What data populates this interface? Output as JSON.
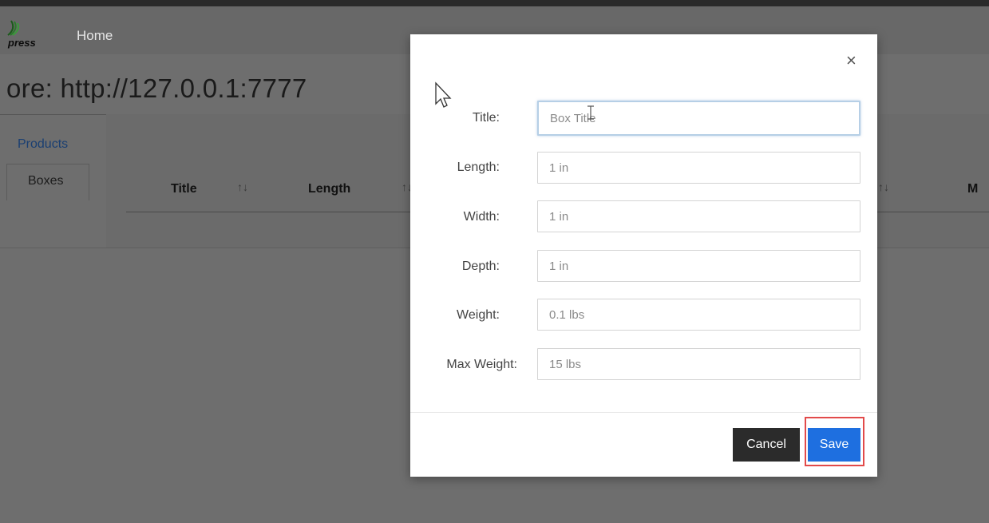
{
  "nav": {
    "logo_text": "press",
    "home": "Home"
  },
  "store": {
    "title": "ore: http://127.0.0.1:7777"
  },
  "tabs": {
    "products": "Products",
    "boxes": "Boxes"
  },
  "table": {
    "headers": [
      "Title",
      "Length",
      "M"
    ],
    "sort_glyph": "↑↓"
  },
  "modal": {
    "close_glyph": "×",
    "fields": [
      {
        "label": "Title:",
        "placeholder": "Box Title",
        "value": ""
      },
      {
        "label": "Length:",
        "placeholder": "1 in",
        "value": ""
      },
      {
        "label": "Width:",
        "placeholder": "1 in",
        "value": ""
      },
      {
        "label": "Depth:",
        "placeholder": "1 in",
        "value": ""
      },
      {
        "label": "Weight:",
        "placeholder": "0.1 lbs",
        "value": ""
      },
      {
        "label": "Max Weight:",
        "placeholder": "15 lbs",
        "value": ""
      }
    ],
    "cancel_label": "Cancel",
    "save_label": "Save"
  },
  "colors": {
    "save": "#1e6fe0",
    "cancel": "#2b2b2b",
    "highlight": "#e24a4a",
    "link": "#1a3f72"
  }
}
